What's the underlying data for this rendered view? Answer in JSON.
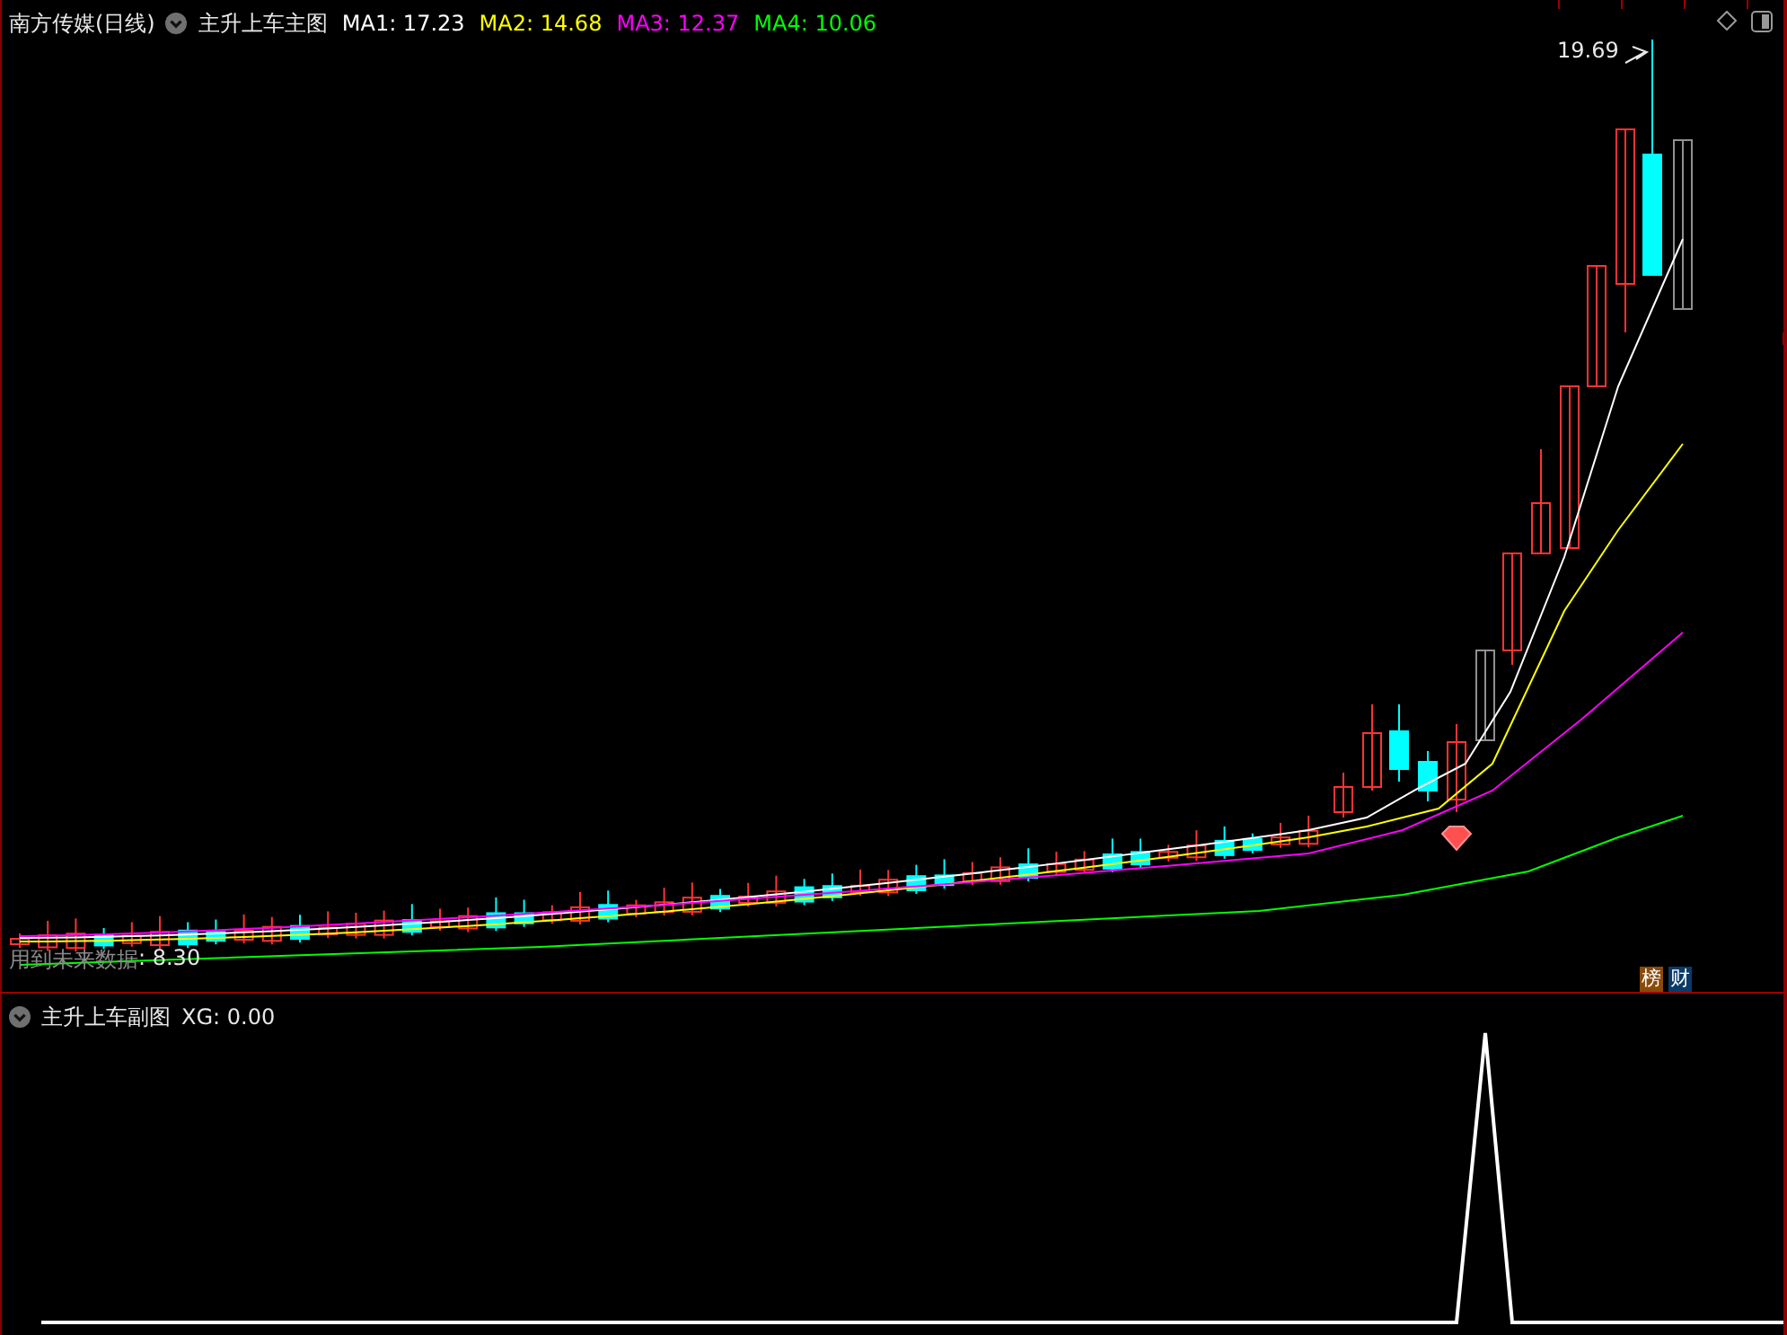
{
  "header": {
    "stock": "南方传媒(日线)",
    "indicator": "主升上车主图",
    "ma": [
      {
        "label": "MA1: 17.23",
        "color": "#ffffff"
      },
      {
        "label": "MA2: 14.68",
        "color": "#ffff00"
      },
      {
        "label": "MA3: 12.37",
        "color": "#ff00ff"
      },
      {
        "label": "MA4: 10.06",
        "color": "#00ff00"
      }
    ]
  },
  "chart": {
    "high_label": "19.69",
    "warning": {
      "label": "用到未来数据",
      "value": ": 8.30"
    },
    "badges": [
      {
        "text": "榜",
        "color": "#8a4a0a"
      },
      {
        "text": "财",
        "color": "#0b3a68"
      }
    ]
  },
  "sub": {
    "indicator": "主升上车副图",
    "reading": "XG: 0.00"
  }
}
